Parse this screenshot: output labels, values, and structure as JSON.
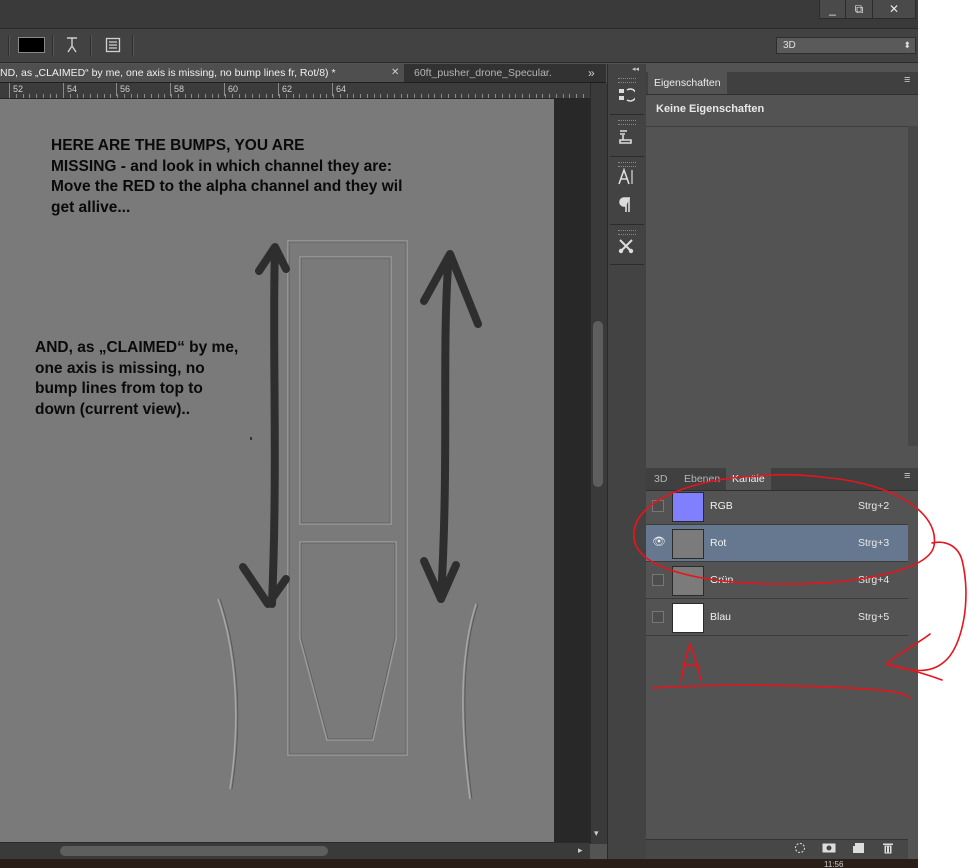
{
  "window": {
    "minimize": "_",
    "restore": "⧉",
    "close": "✕"
  },
  "options_bar": {
    "foreground_color": "#000000",
    "workspace_preset": "3D",
    "preset_arrow": "⬍"
  },
  "document_tabs": [
    {
      "label": "ND, as „CLAIMED“ by me,  one axis is missing, no bump lines fr, Rot/8) *",
      "close": "✕",
      "active": true
    },
    {
      "label": "60ft_pusher_drone_Specular.",
      "active": false
    }
  ],
  "tabs_overflow": "»",
  "ruler": {
    "labels": [
      "52",
      "54",
      "56",
      "58",
      "60",
      "62",
      "64"
    ]
  },
  "canvas": {
    "annotation_top": [
      "HERE ARE THE BUMPS, YOU ARE",
      "MISSING - and look in which channel they are:",
      "Move the RED to the alpha channel and they wil",
      "get allive..."
    ],
    "annotation_left": [
      "AND, as „CLAIMED“ by me,",
      "one axis is missing, no",
      "bump lines from top to",
      "down (current view).."
    ]
  },
  "properties_panel": {
    "tab": "Eigenschaften",
    "empty_text": "Keine Eigenschaften"
  },
  "channels_panel": {
    "tabs": [
      "3D",
      "Ebenen",
      "Kanäle"
    ],
    "active_tab": "Kanäle",
    "channels": [
      {
        "name": "RGB",
        "shortcut": "Strg+2",
        "visible": false,
        "selected": false,
        "thumb_color": "#8080ff"
      },
      {
        "name": "Rot",
        "shortcut": "Strg+3",
        "visible": true,
        "selected": true,
        "thumb_color": "#7b7b7b"
      },
      {
        "name": "Grün",
        "shortcut": "Strg+4",
        "visible": false,
        "selected": false,
        "thumb_color": "#7b7b7b"
      },
      {
        "name": "Blau",
        "shortcut": "Strg+5",
        "visible": false,
        "selected": false,
        "thumb_color": "#ffffff"
      }
    ]
  },
  "red_markup": {
    "letter": "A",
    "color": "#e8141c"
  },
  "taskbar": {
    "clock": "11:56"
  },
  "icons": {
    "panel_menu": "≡",
    "eye": "👁",
    "collapse": "◂◂",
    "scroll_up": "▴",
    "scroll_down": "▾",
    "scroll_right": "▸"
  }
}
